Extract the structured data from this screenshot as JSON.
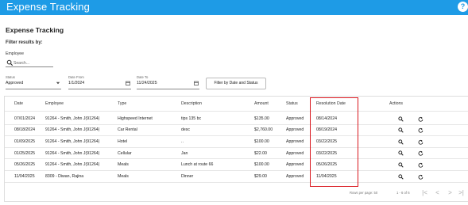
{
  "appbar": {
    "title": "Expense Tracking",
    "help_icon": "?"
  },
  "page": {
    "title": "Expense Tracking",
    "filter_heading": "Filter results by:",
    "employee_label": "Employee"
  },
  "search": {
    "placeholder": "Search..."
  },
  "filters": {
    "status": {
      "label": "Status",
      "value": "Approved"
    },
    "date_from": {
      "label": "Date From",
      "value": "1/1/2024"
    },
    "date_to": {
      "label": "Date To",
      "value": "11/24/2025"
    },
    "button_label": "Filter by Date and Status"
  },
  "table": {
    "headers": [
      "Date",
      "Employee",
      "Type",
      "Description",
      "Amount",
      "Status",
      "Resolution Date",
      "Actions"
    ],
    "rows": [
      [
        "07/01/2024",
        "91264 - Smith, John J(91264)",
        "Highspeed Internet",
        "tips 135 bc",
        "$135.00",
        "Approved",
        "08/14/2024"
      ],
      [
        "08/18/2024",
        "91264 - Smith, John J(91264)",
        "Car Rental",
        "desc",
        "$2,760.00",
        "Approved",
        "08/19/2024"
      ],
      [
        "01/09/2025",
        "91264 - Smith, John J(91264)",
        "Hotel",
        "..",
        "$100.00",
        "Approved",
        "03/22/2025"
      ],
      [
        "01/25/2025",
        "91264 - Smith, John J(91264)",
        "Cellular",
        "Jan",
        "$22.00",
        "Approved",
        "03/22/2025"
      ],
      [
        "05/26/2025",
        "91264 - Smith, John J(91264)",
        "Meals",
        "Lunch at route 66",
        "$100.00",
        "Approved",
        "05/26/2025"
      ],
      [
        "11/04/2025",
        "8309 - Diwan, Rajina",
        "Meals",
        "Dinner",
        "$29.00",
        "Approved",
        "11/04/2025"
      ]
    ]
  },
  "pager": {
    "rows_per_page": "Rows per page: 50",
    "range": "1 - 6 of 6"
  },
  "colors": {
    "appbar": "#1e9be6",
    "highlight": "#d9161d"
  }
}
